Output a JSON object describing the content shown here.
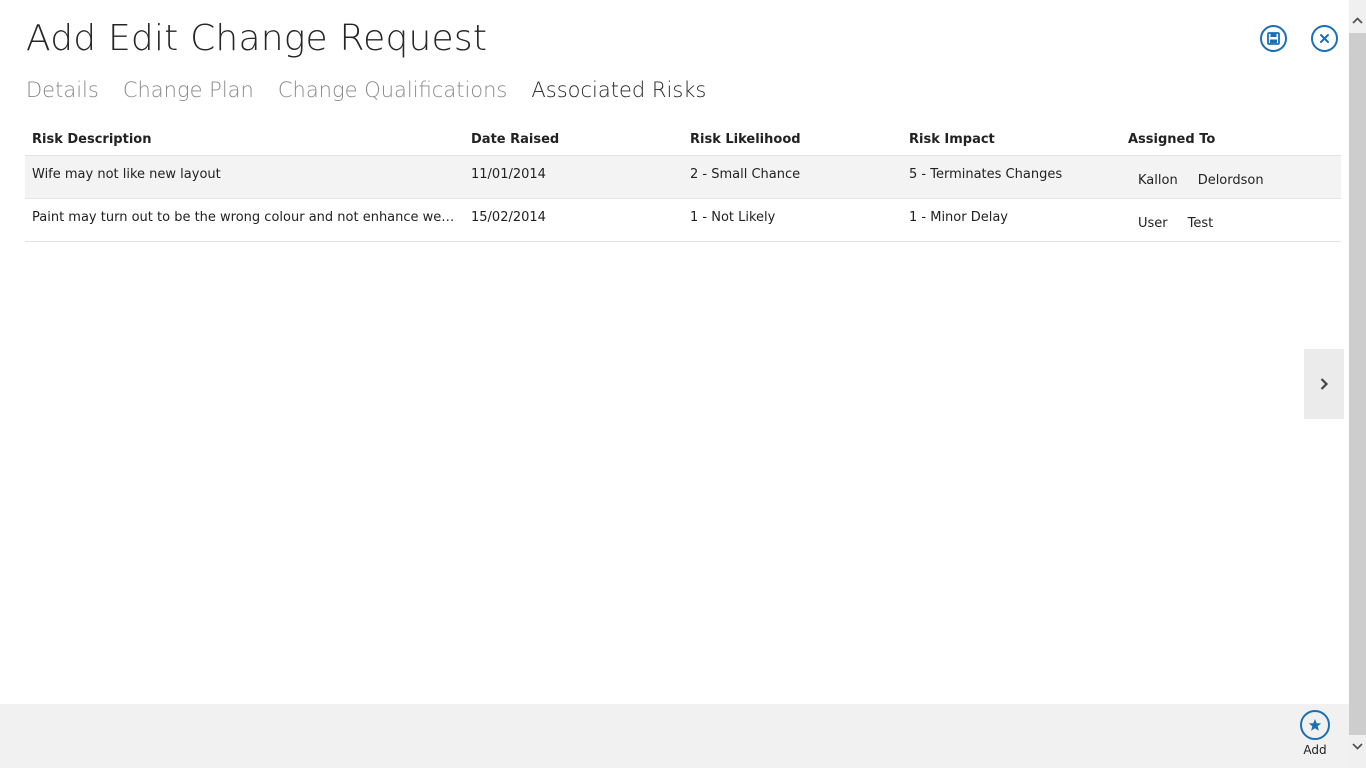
{
  "header": {
    "title": "Add Edit Change Request",
    "save_icon": "save-icon",
    "close_icon": "close-icon",
    "accent_color": "#1a6fb5"
  },
  "tabs": [
    {
      "label": "Details",
      "active": false
    },
    {
      "label": "Change Plan",
      "active": false
    },
    {
      "label": "Change Qualifications",
      "active": false
    },
    {
      "label": "Associated Risks",
      "active": true
    }
  ],
  "risks_table": {
    "columns": [
      "Risk Description",
      "Date Raised",
      "Risk Likelihood",
      "Risk Impact",
      "Assigned To"
    ],
    "rows": [
      {
        "description": "Wife may not like new layout",
        "date_raised": "11/01/2014",
        "likelihood": "2 - Small Chance",
        "impact": "5 - Terminates Changes",
        "assigned_first": "Kallon",
        "assigned_last": "Delordson"
      },
      {
        "description": "Paint may turn out to be the wrong colour and not enhance wellbe...",
        "date_raised": "15/02/2014",
        "likelihood": "1 - Not Likely",
        "impact": "1 - Minor Delay",
        "assigned_first": "User",
        "assigned_last": "Test"
      }
    ]
  },
  "navigation": {
    "next_icon": "chevron-right-icon"
  },
  "app_bar": {
    "add_label": "Add",
    "add_icon": "star-icon"
  }
}
